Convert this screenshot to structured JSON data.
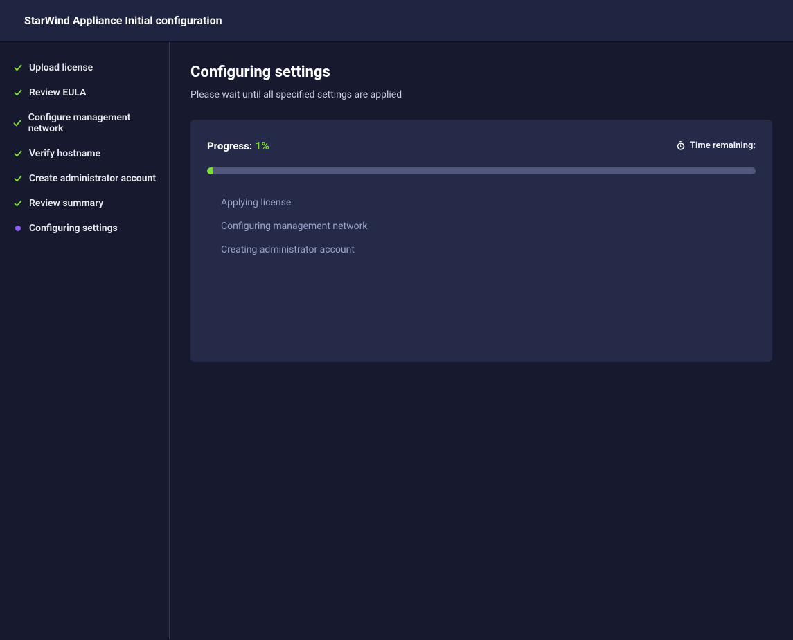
{
  "header": {
    "title": "StarWind Appliance Initial configuration"
  },
  "sidebar": {
    "items": [
      {
        "label": "Upload license",
        "state": "done"
      },
      {
        "label": "Review EULA",
        "state": "done"
      },
      {
        "label": "Configure management network",
        "state": "done"
      },
      {
        "label": "Verify hostname",
        "state": "done"
      },
      {
        "label": "Create administrator account",
        "state": "done"
      },
      {
        "label": "Review summary",
        "state": "done"
      },
      {
        "label": "Configuring settings",
        "state": "active"
      }
    ]
  },
  "main": {
    "title": "Configuring settings",
    "subtitle": "Please wait until all specified settings are applied",
    "progress": {
      "label": "Progress:",
      "value_text": "1%",
      "value_percent": 1,
      "time_remaining_label": "Time remaining:",
      "time_remaining_value": ""
    },
    "steps": [
      {
        "label": "Applying license"
      },
      {
        "label": "Configuring management network"
      },
      {
        "label": "Creating administrator account"
      }
    ]
  },
  "colors": {
    "accent_green": "#7cdc3a",
    "accent_purple": "#8b5cf6",
    "panel_bg": "#242a47",
    "body_bg": "#171a2e",
    "header_bg": "#1f2540"
  }
}
